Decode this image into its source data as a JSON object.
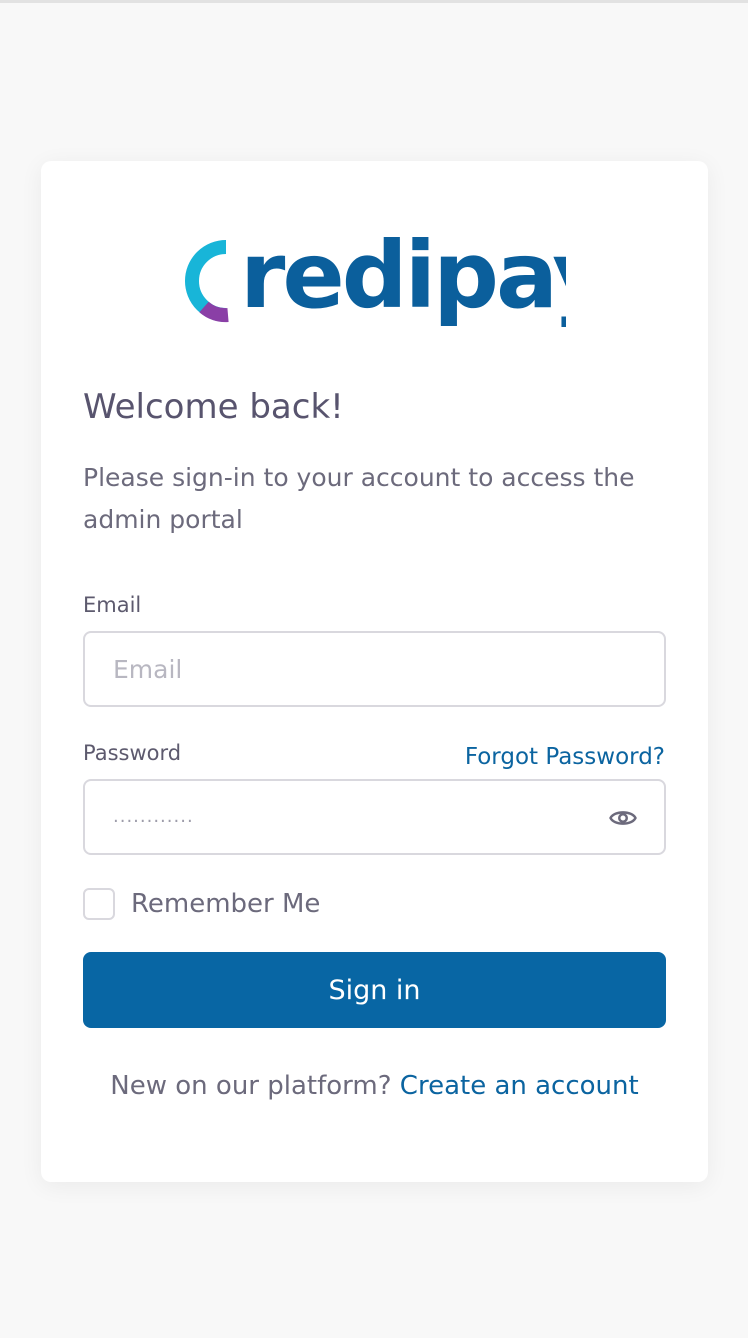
{
  "brand": {
    "name": "Credipay",
    "colors": {
      "primary": "#0b5f9c",
      "accent_cyan": "#18b5d8",
      "accent_purple": "#8a3fa6"
    }
  },
  "heading": "Welcome back!",
  "subtitle": "Please sign-in to your account to access the admin portal",
  "email": {
    "label": "Email",
    "placeholder": "Email",
    "value": ""
  },
  "password": {
    "label": "Password",
    "masked_value": "............",
    "visibility_icon": "eye-icon",
    "forgot_link": "Forgot Password?"
  },
  "remember_me": {
    "label": "Remember Me",
    "checked": false
  },
  "sign_in_button": "Sign in",
  "footer": {
    "prompt": "New on our platform?",
    "link": "Create an account"
  }
}
